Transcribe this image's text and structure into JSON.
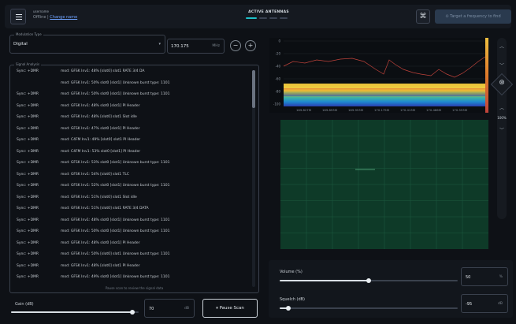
{
  "header": {
    "user_name": "username",
    "status_prefix": "Offline | ",
    "status_link": "Change name",
    "active_title": "ACTIVE ANTENNAS",
    "target_button": "Target a frequency to find"
  },
  "modulation": {
    "legend": "Modulation Type",
    "value": "Digital"
  },
  "frequency": {
    "value": "170.175",
    "unit": "MHz"
  },
  "analysis": {
    "legend": "Signal Analysis",
    "pause_hint": "Pause scan to review the signal data",
    "rows": [
      {
        "sync": "Sync: +DMR",
        "detail": "mod: GFSK Inv1: 48% [slot0]  slot1  RATE 3/4 DA"
      },
      {
        "sync": "",
        "detail": "mod: GFSK Inv1: 50%  slot0  [slot1]  Unknown burst type: 1101"
      },
      {
        "sync": "Sync: +DMR",
        "detail": "mod: GFSK Inv1: 50%  slot0  [slot1]  Unknown burst type: 1101"
      },
      {
        "sync": "Sync: +DMR",
        "detail": "mod: GFSK Inv1: 48%  slot0  [slot1]  PI Header"
      },
      {
        "sync": "Sync: +DMR",
        "detail": "mod: GFSK Inv1: 48% [slot0]  slot1  Slot idle"
      },
      {
        "sync": "Sync: +DMR",
        "detail": "mod: GFSK Inv1: 47%  slot0  [slot1]  PI Header"
      },
      {
        "sync": "Sync: +DMR",
        "detail": "mod: C4FM Inv1: 49% [slot0]  slot1  PI Header"
      },
      {
        "sync": "Sync: +DMR",
        "detail": "mod: C4FM Inv1: 53%  slot0  [slot1]  PI Header"
      },
      {
        "sync": "Sync: +DMR",
        "detail": "mod: GFSK Inv1: 53%  slot0  [slot1]  Unknown burst type: 1101"
      },
      {
        "sync": "Sync: +DMR",
        "detail": "mod: GFSK Inv1: 54% [slot0]  slot1  TLC"
      },
      {
        "sync": "Sync: +DMR",
        "detail": "mod: GFSK Inv1: 52%  slot0  [slot1]  Unknown burst type: 1101"
      },
      {
        "sync": "Sync: +DMR",
        "detail": "mod: GFSK Inv1: 51% [slot0]  slot1  Slot idle"
      },
      {
        "sync": "Sync: +DMR",
        "detail": "mod: GFSK Inv1: 51% [slot0]  slot1  RATE 3/4 DATA"
      },
      {
        "sync": "Sync: +DMR",
        "detail": "mod: GFSK Inv1: 48%  slot0  [slot1]  Unknown burst type: 1101"
      },
      {
        "sync": "Sync: +DMR",
        "detail": "mod: GFSK Inv1: 50%  slot0  [slot1]  Unknown burst type: 1101"
      },
      {
        "sync": "Sync: +DMR",
        "detail": "mod: GFSK Inv1: 48%  slot0  [slot1]  PI Header"
      },
      {
        "sync": "Sync: +DMR",
        "detail": "mod: GFSK Inv1: 50% [slot0]  slot1  Unknown burst type: 1101"
      },
      {
        "sync": "Sync: +DMR",
        "detail": "mod: GFSK Inv1: 48% [slot0]  slot1  PI Header"
      },
      {
        "sync": "Sync: +DMR",
        "detail": "mod: GFSK Inv1: 49%  slot0  [slot1]  Unknown burst type: 1101"
      }
    ]
  },
  "gain": {
    "label": "Gain (dB)",
    "value": "70",
    "unit": "dB",
    "level": 0.95
  },
  "pause_button": "Pause Scan",
  "spectrum": {
    "y_ticks": [
      "0",
      "-20",
      "-40",
      "-60",
      "-80",
      "-100"
    ],
    "x_ticks": [
      "169.827M",
      "169.893M",
      "169.953M",
      "170.175M",
      "170.413M",
      "170.486M",
      "170.553M"
    ]
  },
  "zoom": "100%",
  "volume": {
    "label": "Volume (%)",
    "value": "50",
    "unit": "%",
    "level": 0.5
  },
  "squelch": {
    "label": "Squelch (dB)",
    "value": "-95",
    "unit": "dB",
    "level": 0.05
  },
  "colors": {
    "accent": "#6fa3ff",
    "waterfall_bg": "#0e3a28",
    "spectrum_line": "#c0433b"
  },
  "icons": {
    "menu": "hamburger-menu-icon",
    "wave": "signal-wave-icon",
    "target": "target-icon",
    "minus": "minus-icon",
    "plus": "plus-icon",
    "pause": "pause-icon",
    "up": "chevron-up-icon",
    "down": "chevron-down-icon",
    "recenter": "crosshair-icon"
  }
}
